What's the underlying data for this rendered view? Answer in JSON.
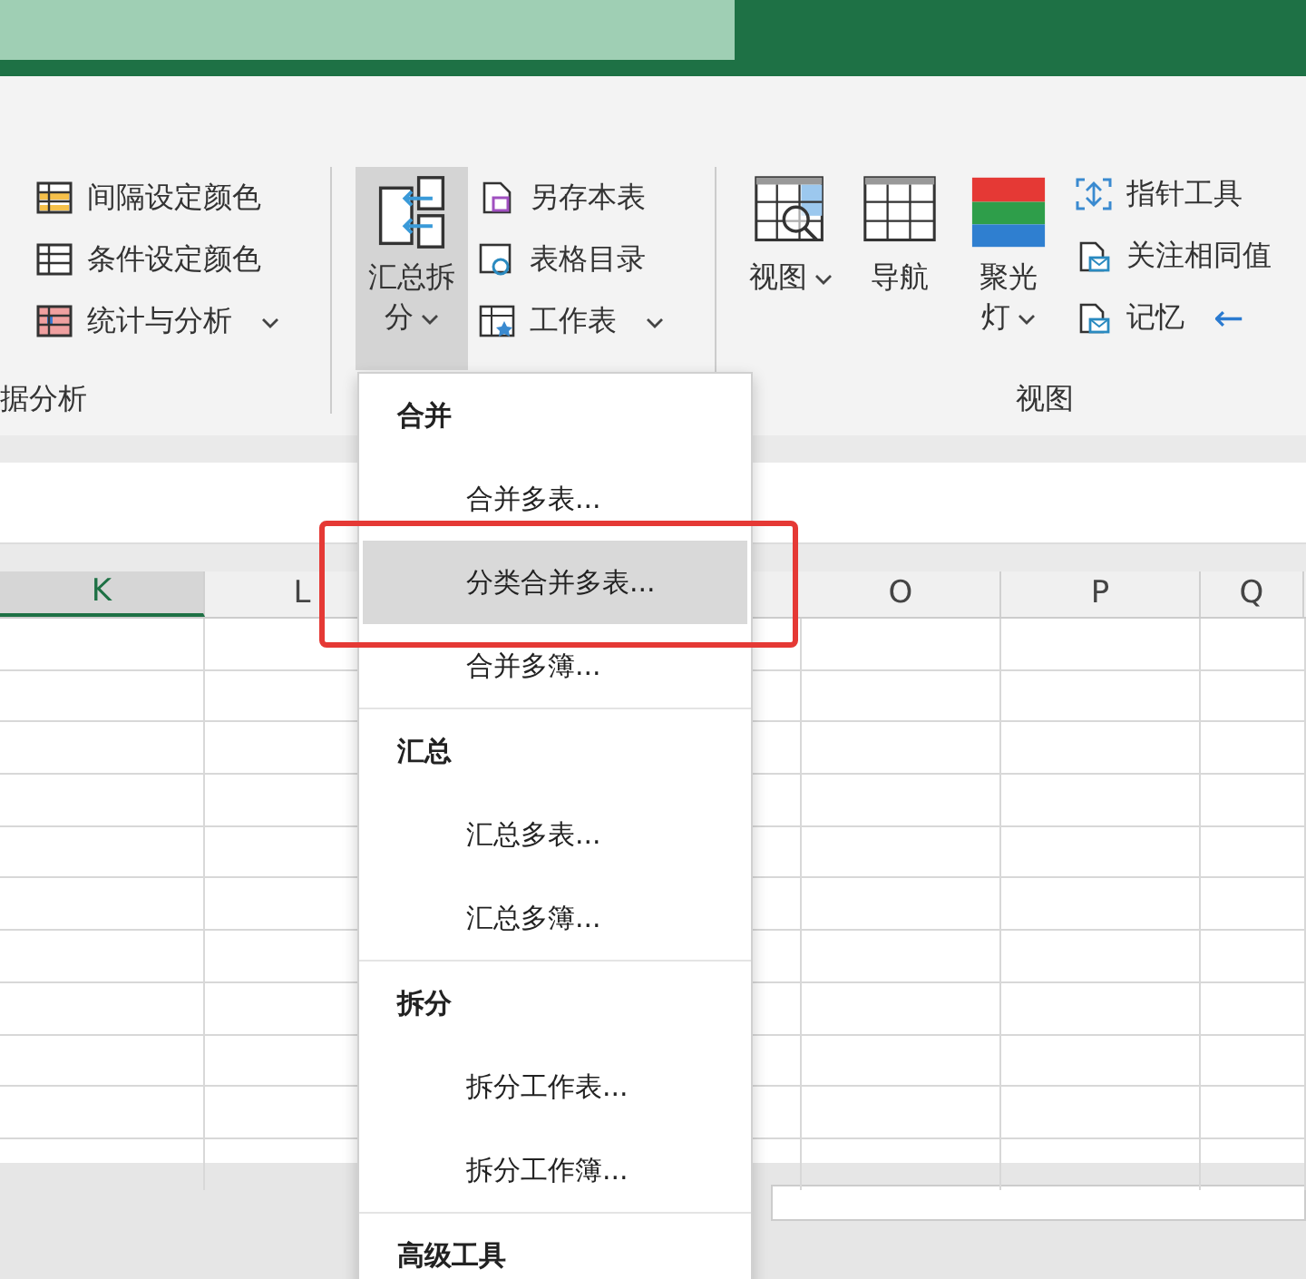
{
  "ribbon": {
    "groups": [
      {
        "label": "据分析",
        "items": [
          {
            "kind": "small",
            "label": "间隔设定颜色",
            "has_menu": false
          },
          {
            "kind": "small",
            "label": "条件设定颜色",
            "has_menu": false
          },
          {
            "kind": "small",
            "label": "统计与分析",
            "has_menu": true
          }
        ]
      },
      {
        "items": [
          {
            "kind": "large",
            "label": "汇总拆分",
            "has_menu": true,
            "expanded": true
          },
          {
            "kind": "small",
            "label": "另存本表",
            "has_menu": false
          },
          {
            "kind": "small",
            "label": "表格目录",
            "has_menu": false
          },
          {
            "kind": "small",
            "label": "工作表",
            "has_menu": true
          }
        ]
      },
      {
        "label": "视图",
        "items": [
          {
            "kind": "large",
            "label": "视图",
            "has_menu": true,
            "expanded": false
          },
          {
            "kind": "large",
            "label": "导航",
            "has_menu": false,
            "expanded": false
          },
          {
            "kind": "large",
            "label": "聚光灯",
            "has_menu": true,
            "expanded": false
          },
          {
            "kind": "small",
            "label": "指针工具",
            "has_menu": false
          },
          {
            "kind": "small",
            "label": "关注相同值",
            "has_menu": false
          },
          {
            "kind": "small",
            "label": "记忆",
            "has_menu": false,
            "arrow": "←"
          }
        ]
      }
    ]
  },
  "sheet": {
    "columns": [
      {
        "label": "K",
        "selected": true
      },
      {
        "label": "L",
        "selected": false
      },
      {
        "label": "O",
        "selected": false
      },
      {
        "label": "P",
        "selected": false
      },
      {
        "label": "Q",
        "selected": false
      }
    ]
  },
  "menu": {
    "sections": [
      {
        "heading": "合并",
        "items": [
          {
            "label": "合并多表...",
            "selected": false
          },
          {
            "label": "分类合并多表...",
            "selected": true
          },
          {
            "label": "合并多簿...",
            "selected": false
          }
        ]
      },
      {
        "heading": "汇总",
        "items": [
          {
            "label": "汇总多表...",
            "selected": false
          },
          {
            "label": "汇总多簿...",
            "selected": false
          }
        ]
      },
      {
        "heading": "拆分",
        "items": [
          {
            "label": "拆分工作表...",
            "selected": false
          },
          {
            "label": "拆分工作簿...",
            "selected": false
          }
        ]
      },
      {
        "heading": "高级工具"
      }
    ]
  }
}
